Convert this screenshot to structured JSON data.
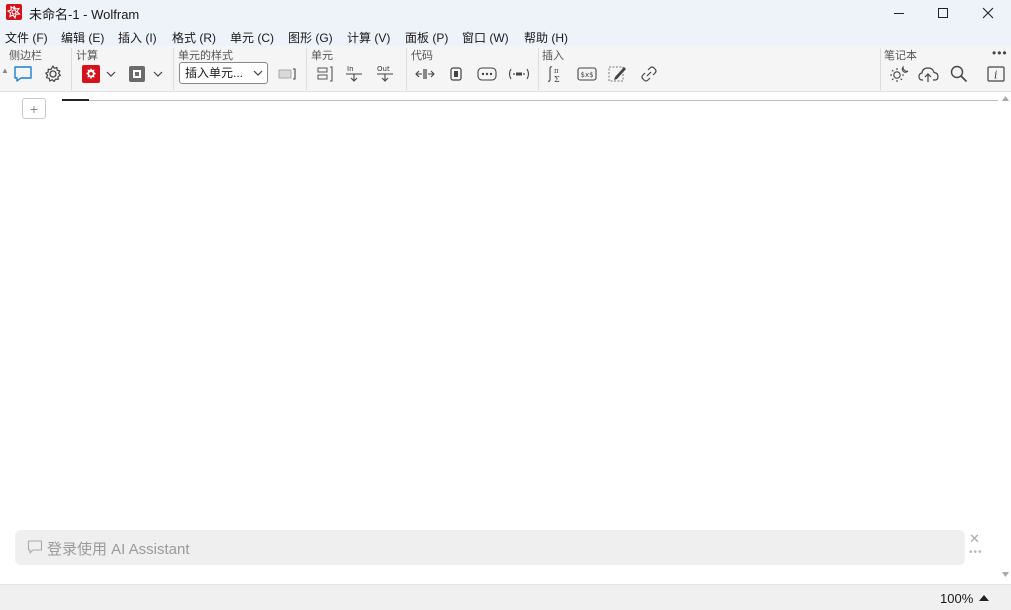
{
  "window": {
    "title": "未命名-1 - Wolfram",
    "brand_color": "#d5121b",
    "icons": [
      "wolfram-logo-icon",
      "minimize-icon",
      "maximize-icon",
      "close-icon"
    ]
  },
  "menu": {
    "items": [
      {
        "label": "文件 (F)"
      },
      {
        "label": "编辑 (E)"
      },
      {
        "label": "插入 (I)"
      },
      {
        "label": "格式 (R)"
      },
      {
        "label": "单元 (C)"
      },
      {
        "label": "图形 (G)"
      },
      {
        "label": "计算 (V)"
      },
      {
        "label": "面板 (P)"
      },
      {
        "label": "窗口 (W)"
      },
      {
        "label": "帮助 (H)"
      }
    ]
  },
  "toolbar": {
    "groups": {
      "sidebar": "侧边栏",
      "evaluate": "计算",
      "cell_style": "单元的样式",
      "cell": "单元",
      "code": "代码",
      "insert": "插入",
      "notebook": "笔记本"
    },
    "style_select_value": "插入单元...",
    "cell_in_label": "In",
    "cell_out_label": "Out",
    "accent_color": "#1a7fd4"
  },
  "ai_assistant": {
    "placeholder": "登录使用 AI Assistant"
  },
  "status": {
    "zoom": "100%"
  }
}
